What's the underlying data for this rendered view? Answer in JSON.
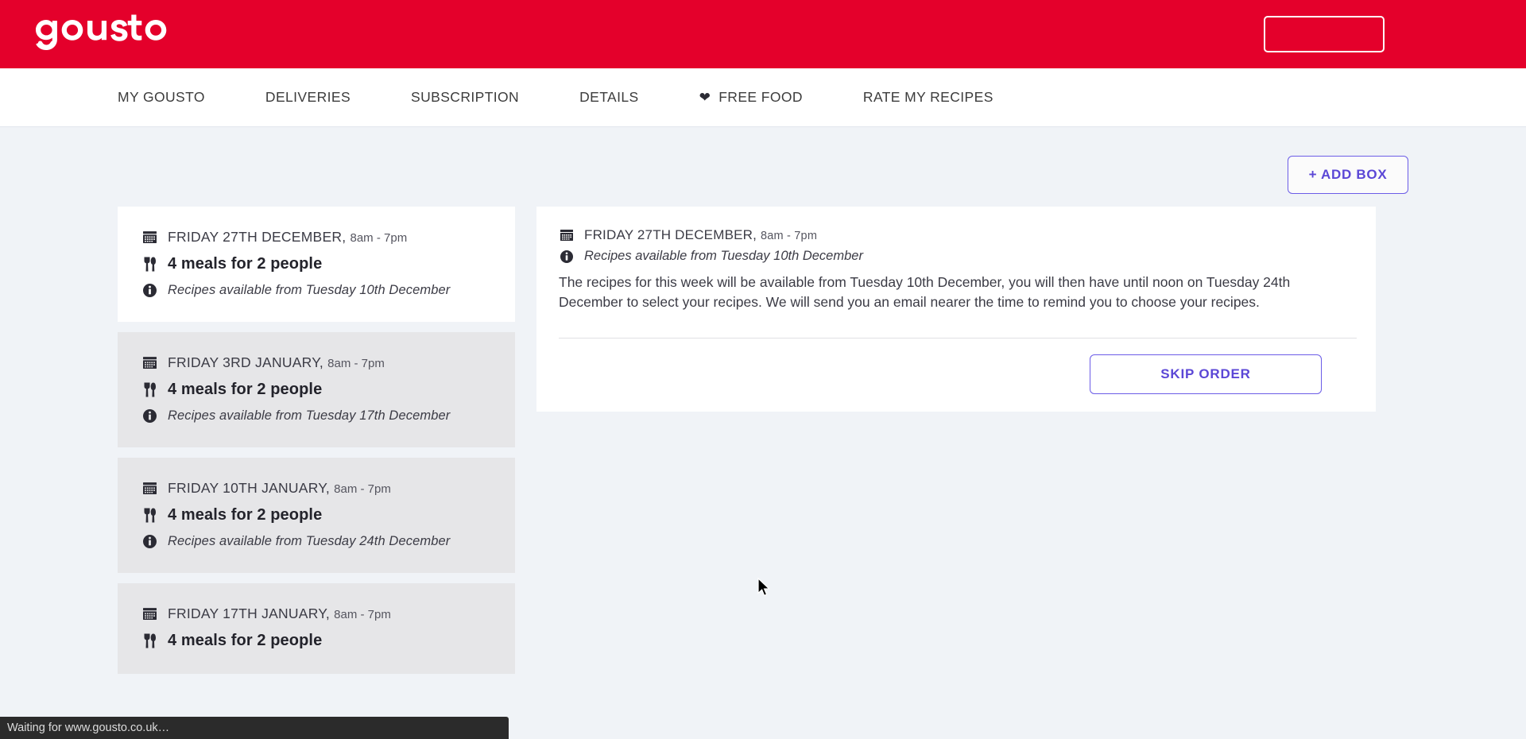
{
  "brand": {
    "logo_text": "gousto",
    "logo_color": "#ffffff",
    "bar_color": "#e4002b",
    "account_button_label": ""
  },
  "nav": {
    "items": [
      {
        "label": "MY GOUSTO",
        "icon": ""
      },
      {
        "label": "DELIVERIES",
        "icon": ""
      },
      {
        "label": "SUBSCRIPTION",
        "icon": ""
      },
      {
        "label": "DETAILS",
        "icon": ""
      },
      {
        "label": "FREE FOOD",
        "icon": "heart-icon"
      },
      {
        "label": "RATE MY RECIPES",
        "icon": ""
      }
    ]
  },
  "toolbar": {
    "add_box_label": "+ ADD BOX",
    "accent_color": "#5b47d6"
  },
  "deliveries": [
    {
      "date": "FRIDAY 27TH DECEMBER,",
      "time": "8am - 7pm",
      "meals": "4 meals for 2 people",
      "recipes": "Recipes available from Tuesday 10th December",
      "selected": true
    },
    {
      "date": "FRIDAY 3RD JANUARY,",
      "time": "8am - 7pm",
      "meals": "4 meals for 2 people",
      "recipes": "Recipes available from Tuesday 17th December",
      "selected": false
    },
    {
      "date": "FRIDAY 10TH JANUARY,",
      "time": "8am - 7pm",
      "meals": "4 meals for 2 people",
      "recipes": "Recipes available from Tuesday 24th December",
      "selected": false
    },
    {
      "date": "FRIDAY 17TH JANUARY,",
      "time": "8am - 7pm",
      "meals": "4 meals for 2 people",
      "recipes": "",
      "selected": false
    }
  ],
  "detail": {
    "date": "FRIDAY 27TH DECEMBER,",
    "time": "8am - 7pm",
    "recipes": "Recipes available from Tuesday 10th December",
    "body": "The recipes for this week will be available from Tuesday 10th December, you will then have until noon on Tuesday 24th December to select your recipes. We will send you an email nearer the time to remind you to choose your recipes.",
    "skip_order_label": "SKIP ORDER"
  },
  "status_bar": {
    "text": "Waiting for www.gousto.co.uk…"
  }
}
